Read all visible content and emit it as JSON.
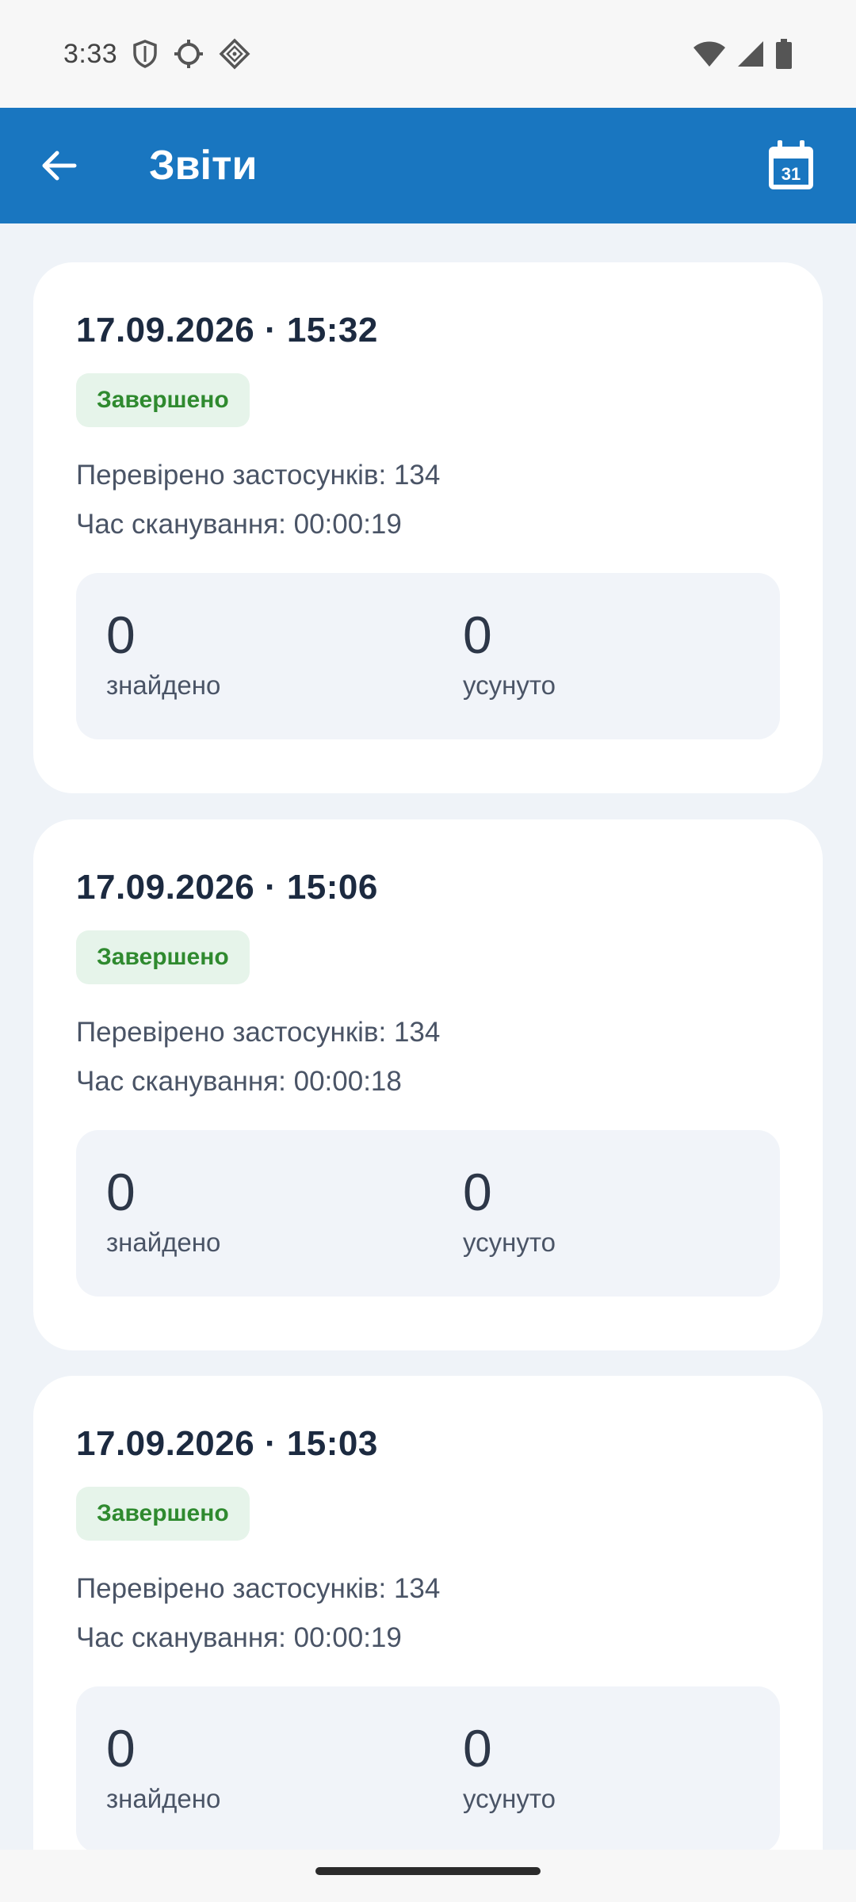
{
  "status_bar": {
    "time": "3:33",
    "icons": [
      "shield-icon",
      "sync-icon",
      "vpn-key-icon",
      "wifi-icon",
      "cell-signal-icon",
      "battery-icon"
    ]
  },
  "app_bar": {
    "title": "Звіти",
    "back_icon": "arrow-back-icon",
    "calendar_icon": "calendar-icon",
    "calendar_day": "31",
    "color": "#1976c0"
  },
  "reports": [
    {
      "datetime": "17.09.2026 · 15:32",
      "status": "Завершено",
      "apps_checked": "Перевірено застосунків: 134",
      "scan_time": "Час сканування: 00:00:19",
      "found_value": "0",
      "found_label": "знайдено",
      "fixed_value": "0",
      "fixed_label": "усунуто"
    },
    {
      "datetime": "17.09.2026 · 15:06",
      "status": "Завершено",
      "apps_checked": "Перевірено застосунків: 134",
      "scan_time": "Час сканування: 00:00:18",
      "found_value": "0",
      "found_label": "знайдено",
      "fixed_value": "0",
      "fixed_label": "усунуто"
    },
    {
      "datetime": "17.09.2026 · 15:03",
      "status": "Завершено",
      "apps_checked": "Перевірено застосунків: 134",
      "scan_time": "Час сканування: 00:00:19",
      "found_value": "0",
      "found_label": "знайдено",
      "fixed_value": "0",
      "fixed_label": "усунуто"
    }
  ],
  "colors": {
    "status_success_bg": "#e6f4ea",
    "status_success_text": "#2f8a2f",
    "page_bg": "#eff3f8"
  }
}
